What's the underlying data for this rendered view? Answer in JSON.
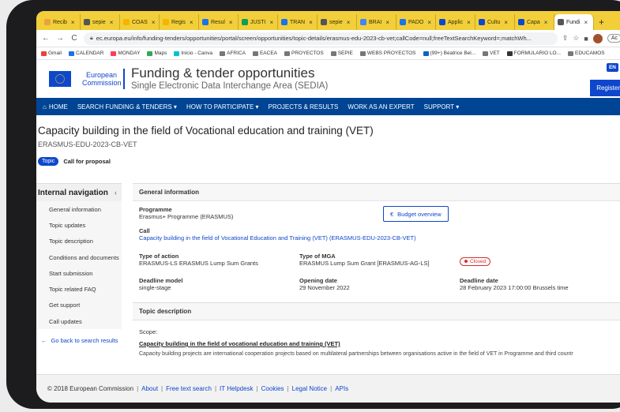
{
  "browser": {
    "tabs": [
      {
        "label": "Recib",
        "color": "#e8a33d"
      },
      {
        "label": "sepie",
        "color": "#555555"
      },
      {
        "label": "COAS",
        "color": "#f4b400"
      },
      {
        "label": "Regis",
        "color": "#f4b400"
      },
      {
        "label": "Resul",
        "color": "#1a73e8"
      },
      {
        "label": "JUSTI",
        "color": "#0f9d58"
      },
      {
        "label": "TRAN",
        "color": "#1a73e8"
      },
      {
        "label": "sepie",
        "color": "#555555"
      },
      {
        "label": "BRAI",
        "color": "#4285f4"
      },
      {
        "label": "PADO",
        "color": "#1a73e8"
      },
      {
        "label": "Applic",
        "color": "#0e47cb"
      },
      {
        "label": "Cultu",
        "color": "#0e47cb"
      },
      {
        "label": "Capa",
        "color": "#0e47cb"
      },
      {
        "label": "Fundi",
        "color": "#555555",
        "active": true
      }
    ],
    "new_tab": "+",
    "url": "ec.europa.eu/info/funding-tenders/opportunities/portal/screen/opportunities/topic-details/erasmus-edu-2023-cb-vet;callCode=null;freeTextSearchKeyword=;matchWh...",
    "profile_label": "Ac",
    "bookmarks": [
      {
        "label": "Gmail",
        "color": "#ea4335"
      },
      {
        "label": "CALENDAR",
        "color": "#1a73e8"
      },
      {
        "label": "MONDAY",
        "color": "#ff3d57"
      },
      {
        "label": "Maps",
        "color": "#34a853"
      },
      {
        "label": "Inicio - Canva",
        "color": "#00c4cc"
      },
      {
        "label": "AFRICA",
        "color": "#777777"
      },
      {
        "label": "EACEA",
        "color": "#777777"
      },
      {
        "label": "PROYECTOS",
        "color": "#777777"
      },
      {
        "label": "SEPIE",
        "color": "#777777"
      },
      {
        "label": "WEBS PROYECTOS",
        "color": "#777777"
      },
      {
        "label": "(99+) Béatrice Bel...",
        "color": "#0a66c2"
      },
      {
        "label": "VET",
        "color": "#777777"
      },
      {
        "label": "FORMULARIO LO...",
        "color": "#333333"
      },
      {
        "label": "EDUCAMOS",
        "color": "#777777"
      }
    ]
  },
  "header": {
    "logo_line1": "European",
    "logo_line2": "Commission",
    "title": "Funding & tender opportunities",
    "subtitle": "Single Electronic Data Interchange Area (SEDIA)",
    "lang": "EN",
    "register": "Register"
  },
  "nav": {
    "items": [
      "HOME",
      "SEARCH FUNDING & TENDERS ▾",
      "HOW TO PARTICIPATE ▾",
      "PROJECTS & RESULTS",
      "WORK AS AN EXPERT",
      "SUPPORT ▾"
    ]
  },
  "page": {
    "title": "Capacity building in the field of Vocational education and training (VET)",
    "code": "ERASMUS-EDU-2023-CB-VET",
    "tab_topic": "Topic",
    "tab_call": "Call for proposal"
  },
  "sidebar": {
    "title": "Internal navigation",
    "items": [
      "General information",
      "Topic updates",
      "Topic description",
      "Conditions and documents",
      "Start submission",
      "Topic related FAQ",
      "Get support",
      "Call updates"
    ],
    "back": "Go back to search results"
  },
  "general": {
    "heading": "General information",
    "programme_label": "Programme",
    "programme_value": "Erasmus+ Programme (ERASMUS)",
    "budget_button": "Budget overview",
    "call_label": "Call",
    "call_value": "Capacity building in the field of Vocational Education and Training (VET) (ERASMUS-EDU-2023-CB-VET)",
    "type_action_label": "Type of action",
    "type_action_value": "ERASMUS-LS ERASMUS Lump Sum Grants",
    "type_mga_label": "Type of MGA",
    "type_mga_value": "ERASMUS Lump Sum Grant [ERASMUS-AG-LS]",
    "status": "Closed",
    "deadline_model_label": "Deadline model",
    "deadline_model_value": "single-stage",
    "opening_label": "Opening date",
    "opening_value": "29 November 2022",
    "deadline_label": "Deadline date",
    "deadline_value": "28 February 2023 17:00:00 Brussels time"
  },
  "description": {
    "heading": "Topic description",
    "scope_label": "Scope:",
    "scope_title": "Capacity building in the field of vocational education and training (VET)",
    "text": "Capacity building projects are international cooperation projects based on multilateral partnerships between organisations active in the field of VET in Programme and third countr"
  },
  "footer": {
    "copyright": "© 2018 European Commission",
    "links": [
      "About",
      "Free text search",
      "IT Helpdesk",
      "Cookies",
      "Legal Notice",
      "APIs"
    ]
  }
}
